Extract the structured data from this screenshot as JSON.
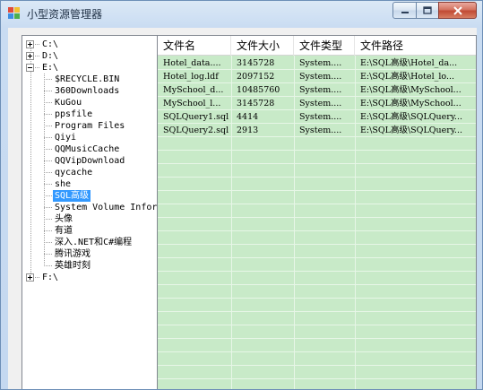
{
  "window": {
    "title": "小型资源管理器"
  },
  "caption_buttons": {
    "minimize": "minimize-icon",
    "maximize": "maximize-icon",
    "close": "close-icon"
  },
  "tree": {
    "roots": [
      {
        "label": "C:\\",
        "expanded": false
      },
      {
        "label": "D:\\",
        "expanded": false
      },
      {
        "label": "E:\\",
        "expanded": true,
        "children": [
          "$RECYCLE.BIN",
          "360Downloads",
          "KuGou",
          "ppsfile",
          "Program Files",
          "Qiyi",
          "QQMusicCache",
          "QQVipDownload",
          "qycache",
          "she",
          "SQL高级",
          "System Volume Information",
          "头像",
          "有道",
          "深入.NET和C#编程",
          "腾讯游戏",
          "英雄时刻"
        ],
        "selected": "SQL高级"
      },
      {
        "label": "F:\\",
        "expanded": false
      }
    ]
  },
  "list": {
    "columns": [
      "文件名",
      "文件大小",
      "文件类型",
      "文件路径"
    ],
    "rows": [
      [
        "Hotel_data....",
        "3145728",
        "System....",
        "E:\\SQL高级\\Hotel_da..."
      ],
      [
        "Hotel_log.ldf",
        "2097152",
        "System....",
        "E:\\SQL高级\\Hotel_lo..."
      ],
      [
        "MySchool_d...",
        "10485760",
        "System....",
        "E:\\SQL高级\\MySchool..."
      ],
      [
        "MySchool_l...",
        "3145728",
        "System....",
        "E:\\SQL高级\\MySchool..."
      ],
      [
        "SQLQuery1.sql",
        "4414",
        "System....",
        "E:\\SQL高级\\SQLQuery..."
      ],
      [
        "SQLQuery2.sql",
        "2913",
        "System....",
        "E:\\SQL高级\\SQLQuery..."
      ]
    ]
  }
}
